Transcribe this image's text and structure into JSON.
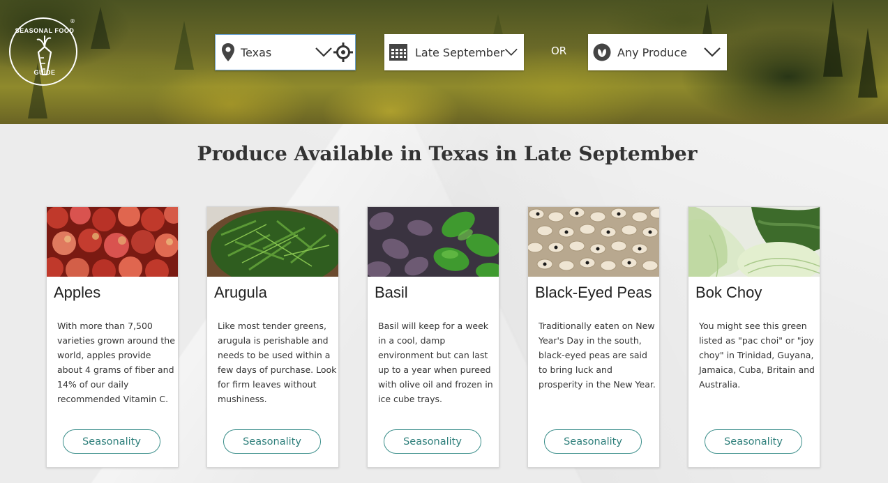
{
  "logo": {
    "line1": "SEASONAL FOOD",
    "line2": "GUIDE",
    "mark": "®"
  },
  "filters": {
    "location": {
      "value": "Texas",
      "icon": "map-pin-icon"
    },
    "time": {
      "value": "Late September",
      "icon": "calendar-icon"
    },
    "or_label": "OR",
    "produce": {
      "value": "Any Produce",
      "icon": "produce-icon"
    }
  },
  "page": {
    "title": "Produce Available in Texas in Late September"
  },
  "colors": {
    "accent": "#2e7f7b",
    "button_border": "#3a8e8a"
  },
  "cards": [
    {
      "name": "Apples",
      "description": "With more than 7,500 varieties grown around the world, apples provide about 4 grams of fiber and 14% of our daily recommended Vitamin C.",
      "button": "Seasonality"
    },
    {
      "name": "Arugula",
      "description": "Like most tender greens, arugula is perishable and needs to be used within a few days of purchase. Look for firm leaves without mushiness.",
      "button": "Seasonality"
    },
    {
      "name": "Basil",
      "description": "Basil will keep for a week in a cool, damp environment but can last up to a year when pureed with olive oil and frozen in ice cube trays.",
      "button": "Seasonality"
    },
    {
      "name": "Black-Eyed Peas",
      "description": "Traditionally eaten on New Year's Day in the south, black-eyed peas are said to bring luck and prosperity in the New Year.",
      "button": "Seasonality"
    },
    {
      "name": "Bok Choy",
      "description": "You might see this green listed as \"pac choi\" or \"joy choy\" in Trinidad, Guyana, Jamaica, Cuba, Britain and Australia.",
      "button": "Seasonality"
    }
  ]
}
